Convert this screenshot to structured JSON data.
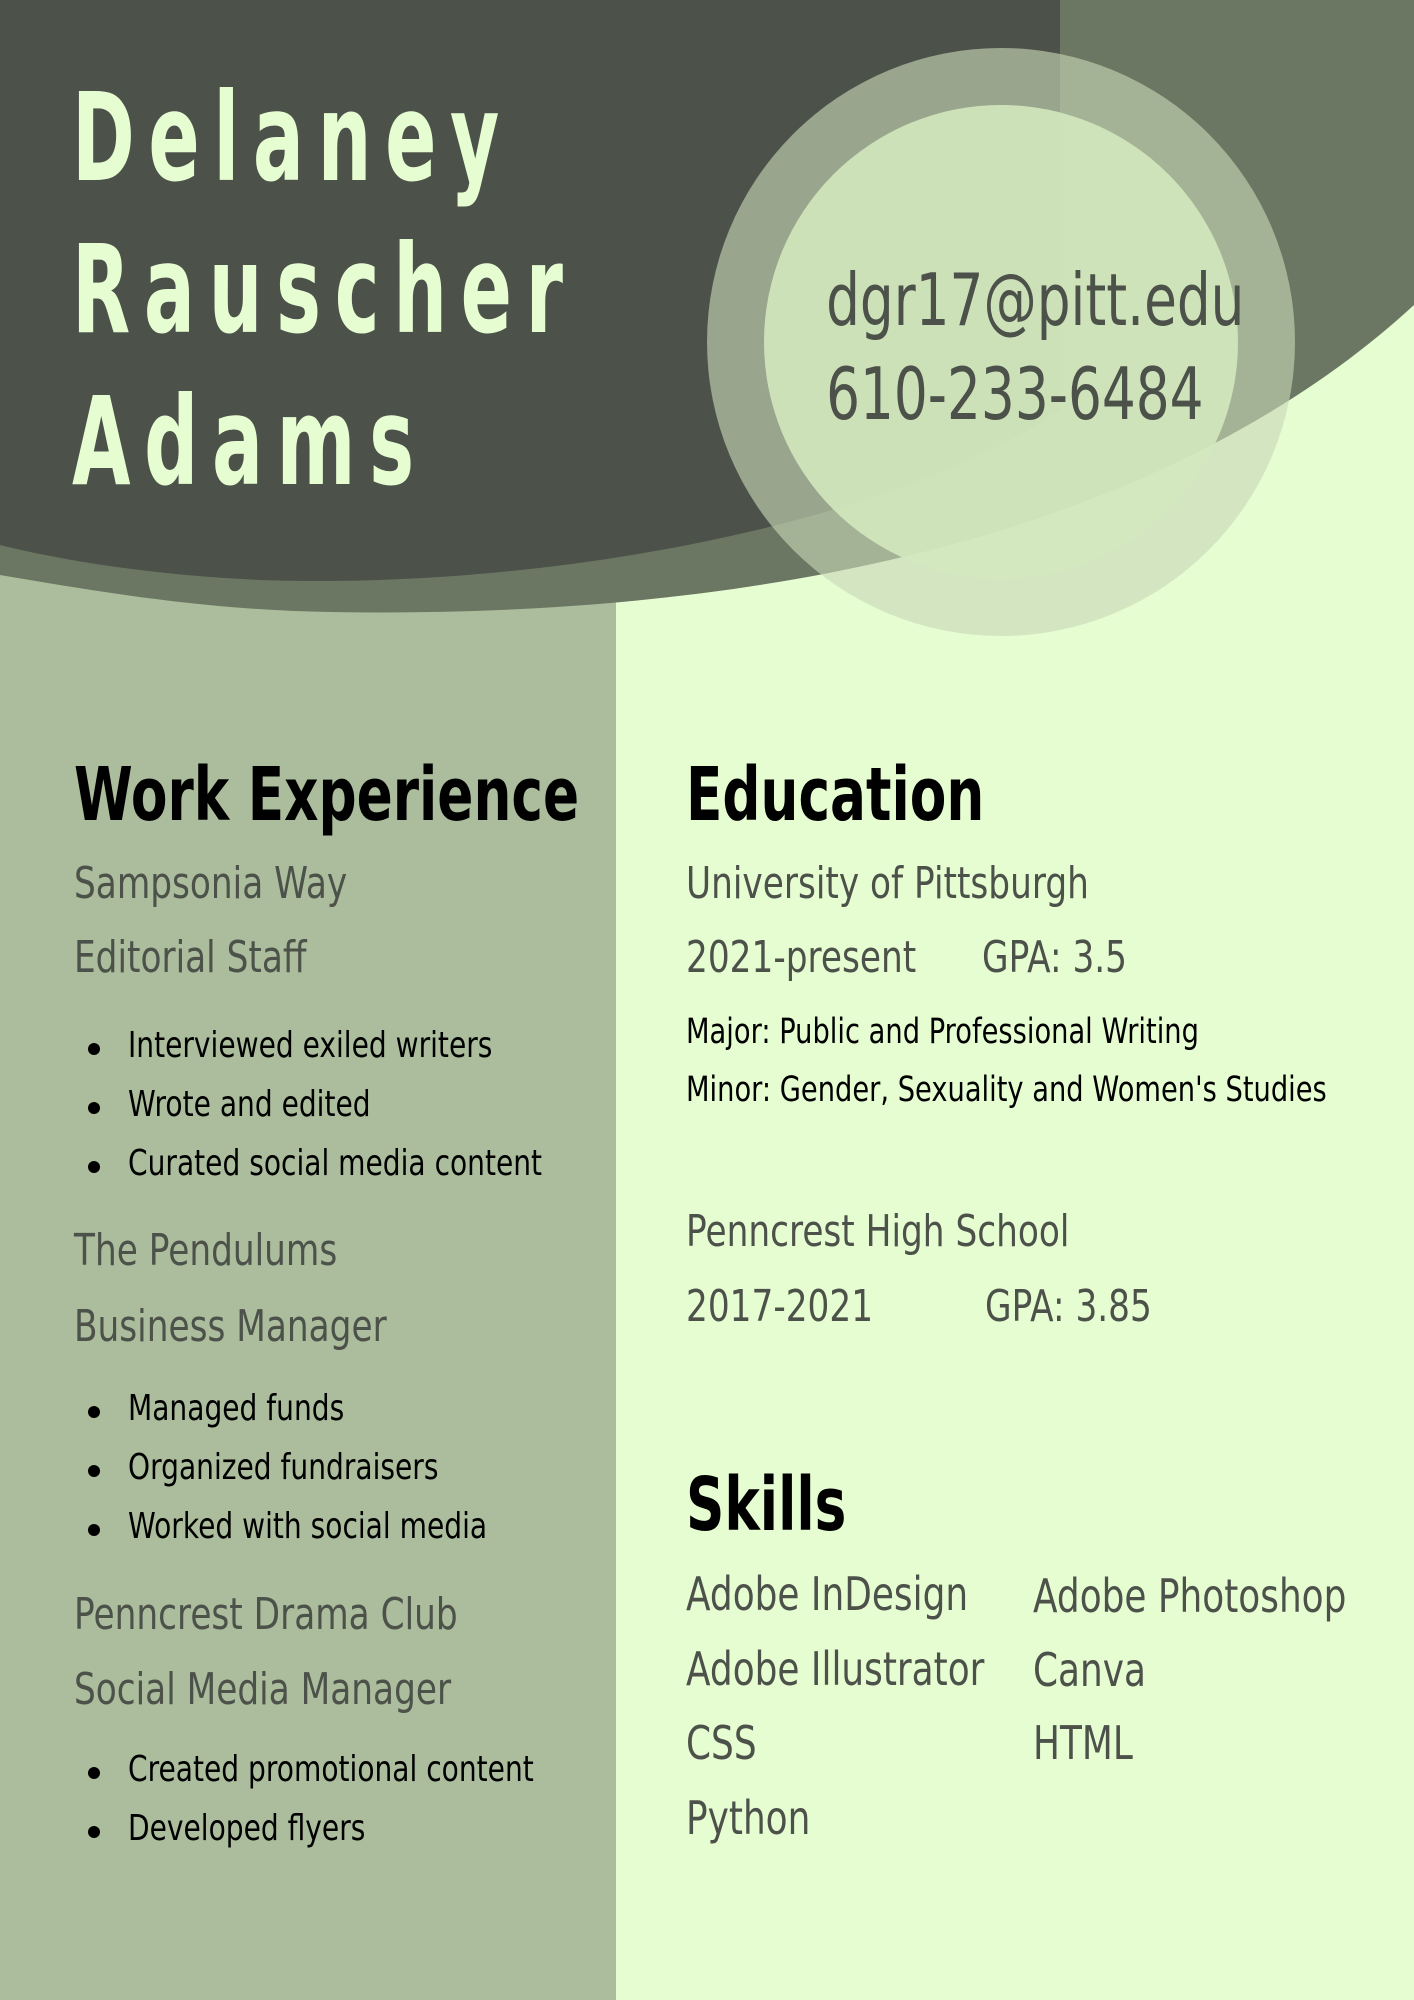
{
  "header": {
    "name_lines": [
      "Delaney",
      "Rauscher",
      "Adams"
    ],
    "email": "dgr17@pitt.edu",
    "phone": "610-233-6484"
  },
  "work": {
    "title": "Work Experience",
    "jobs": [
      {
        "org": "Sampsonia Way",
        "role": "Editorial Staff",
        "bullets": [
          "Interviewed exiled writers",
          "Wrote and edited",
          "Curated social media content"
        ]
      },
      {
        "org": "The Pendulums",
        "role": "Business Manager",
        "bullets": [
          "Managed funds",
          "Organized fundraisers",
          "Worked with social media"
        ]
      },
      {
        "org": "Penncrest Drama Club",
        "role": "Social Media Manager",
        "bullets": [
          "Created promotional content",
          "Developed flyers"
        ]
      }
    ]
  },
  "education": {
    "title": "Education",
    "schools": [
      {
        "name": "University of Pittsburgh",
        "years": "2021-present",
        "gpa": "GPA: 3.5",
        "major": "Major: Public and Professional Writing",
        "minor": "Minor: Gender, Sexuality and Women's Studies"
      },
      {
        "name": "Penncrest High School",
        "years": "2017-2021",
        "gpa": "GPA: 3.85"
      }
    ]
  },
  "skills": {
    "title": "Skills",
    "left": [
      "Adobe InDesign",
      "Adobe Illustrator",
      "CSS",
      "Python"
    ],
    "right": [
      "Adobe Photoshop",
      "Canva",
      "HTML"
    ]
  },
  "colors": {
    "dark": "#4c514a",
    "mid": "#6b7762",
    "sage": "#abbd9c",
    "light": "#e6fdd2",
    "circle_ring": "#9aac8a",
    "circle_inner": "#d3e8be"
  }
}
